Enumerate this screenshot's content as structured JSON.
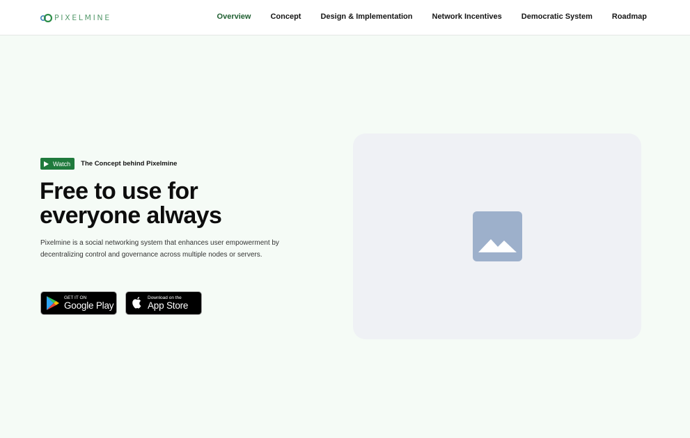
{
  "header": {
    "logo": {
      "text": "PIXELMINE",
      "icon": "pixelmine-logo-icon",
      "color": "#5a9c70"
    },
    "nav": [
      {
        "label": "Overview",
        "active": true
      },
      {
        "label": "Concept",
        "active": false
      },
      {
        "label": "Design & Implementation",
        "active": false
      },
      {
        "label": "Network Incentives",
        "active": false
      },
      {
        "label": "Democratic System",
        "active": false
      },
      {
        "label": "Roadmap",
        "active": false
      }
    ]
  },
  "hero": {
    "watch_label": "Watch",
    "watch_icon": "play-icon",
    "watch_caption": "The Concept behind Pixelmine",
    "title_line1": "Free to use for",
    "title_line2": "everyone always",
    "description": "Pixelmine is a social networking system that enhances user empowerment by decentralizing control and governance across multiple nodes or servers.",
    "google_play": {
      "small": "GET IT ON",
      "big": "Google Play",
      "icon": "google-play-icon"
    },
    "app_store": {
      "small": "Download on the",
      "big": "App Store",
      "icon": "apple-icon"
    }
  },
  "media": {
    "icon": "image-placeholder-icon"
  },
  "colors": {
    "accent": "#1f7a3c",
    "nav_active": "#1f5f31",
    "page_background": "#f5fbf6",
    "media_background": "#eff1f5",
    "placeholder_icon": "#9db0cb"
  }
}
